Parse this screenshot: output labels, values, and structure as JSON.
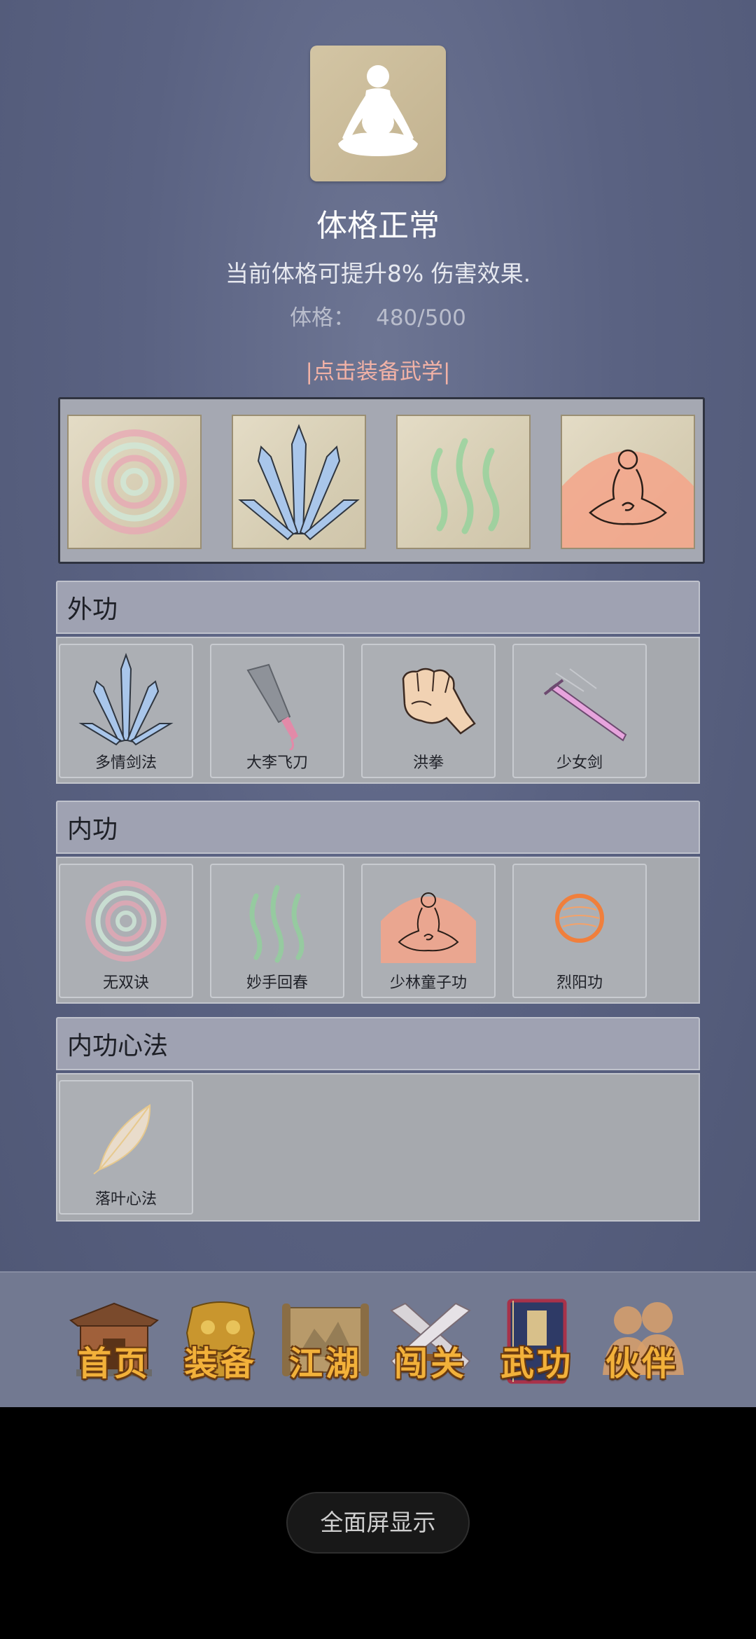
{
  "status": {
    "title": "体格正常",
    "description": "当前体格可提升8% 伤害效果.",
    "stat_label": "体格：",
    "stat_value": "480/500",
    "stat_progress": 0.96
  },
  "equip_link": "|点击装备武学|",
  "equipped_slots": [
    {
      "icon": "swirl-icon"
    },
    {
      "icon": "sword-fan-icon"
    },
    {
      "icon": "green-waves-icon"
    },
    {
      "icon": "meditating-monk-icon"
    }
  ],
  "sections": {
    "outer": {
      "title": "外功",
      "items": [
        {
          "label": "多情剑法",
          "icon": "sword-fan-icon"
        },
        {
          "label": "大李飞刀",
          "icon": "flying-knife-icon"
        },
        {
          "label": "洪拳",
          "icon": "fist-icon"
        },
        {
          "label": "少女剑",
          "icon": "pink-sword-icon"
        }
      ]
    },
    "inner": {
      "title": "内功",
      "items": [
        {
          "label": "无双诀",
          "icon": "swirl-icon"
        },
        {
          "label": "妙手回春",
          "icon": "green-waves-icon"
        },
        {
          "label": "少林童子功",
          "icon": "meditating-monk-icon"
        },
        {
          "label": "烈阳功",
          "icon": "sun-orb-icon"
        }
      ]
    },
    "mind": {
      "title": "内功心法",
      "items": [
        {
          "label": "落叶心法",
          "icon": "leaf-icon"
        }
      ]
    }
  },
  "nav": [
    {
      "label": "首页",
      "icon": "temple-icon"
    },
    {
      "label": "装备",
      "icon": "armor-icon"
    },
    {
      "label": "江湖",
      "icon": "scroll-map-icon"
    },
    {
      "label": "闯关",
      "icon": "crossed-swords-icon"
    },
    {
      "label": "武功",
      "icon": "book-icon"
    },
    {
      "label": "伙伴",
      "icon": "companions-icon"
    }
  ],
  "fullscreen_button": "全面屏显示",
  "colors": {
    "background": "#5a6282",
    "accent_link": "#f2b2a6",
    "nav_text": "#f2b13a"
  }
}
